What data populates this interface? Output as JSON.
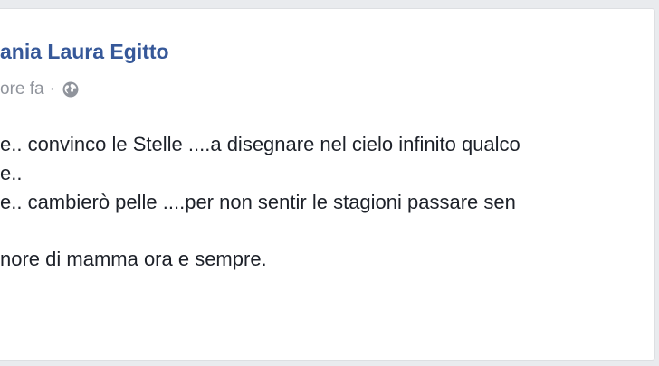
{
  "post": {
    "author": "ania Laura Egitto",
    "timestamp": "ore fa",
    "separator": "·",
    "privacy_icon": "globe-icon",
    "lines": [
      "e.. convinco le Stelle ....a disegnare nel cielo infinito qualco",
      "e..",
      "e.. cambierò pelle ....per non sentir le stagioni passare sen",
      "nore di mamma ora e sempre."
    ]
  },
  "colors": {
    "author_link": "#365899",
    "meta_text": "#90949c",
    "body_text": "#1d2129",
    "page_background": "#e9ebee"
  }
}
